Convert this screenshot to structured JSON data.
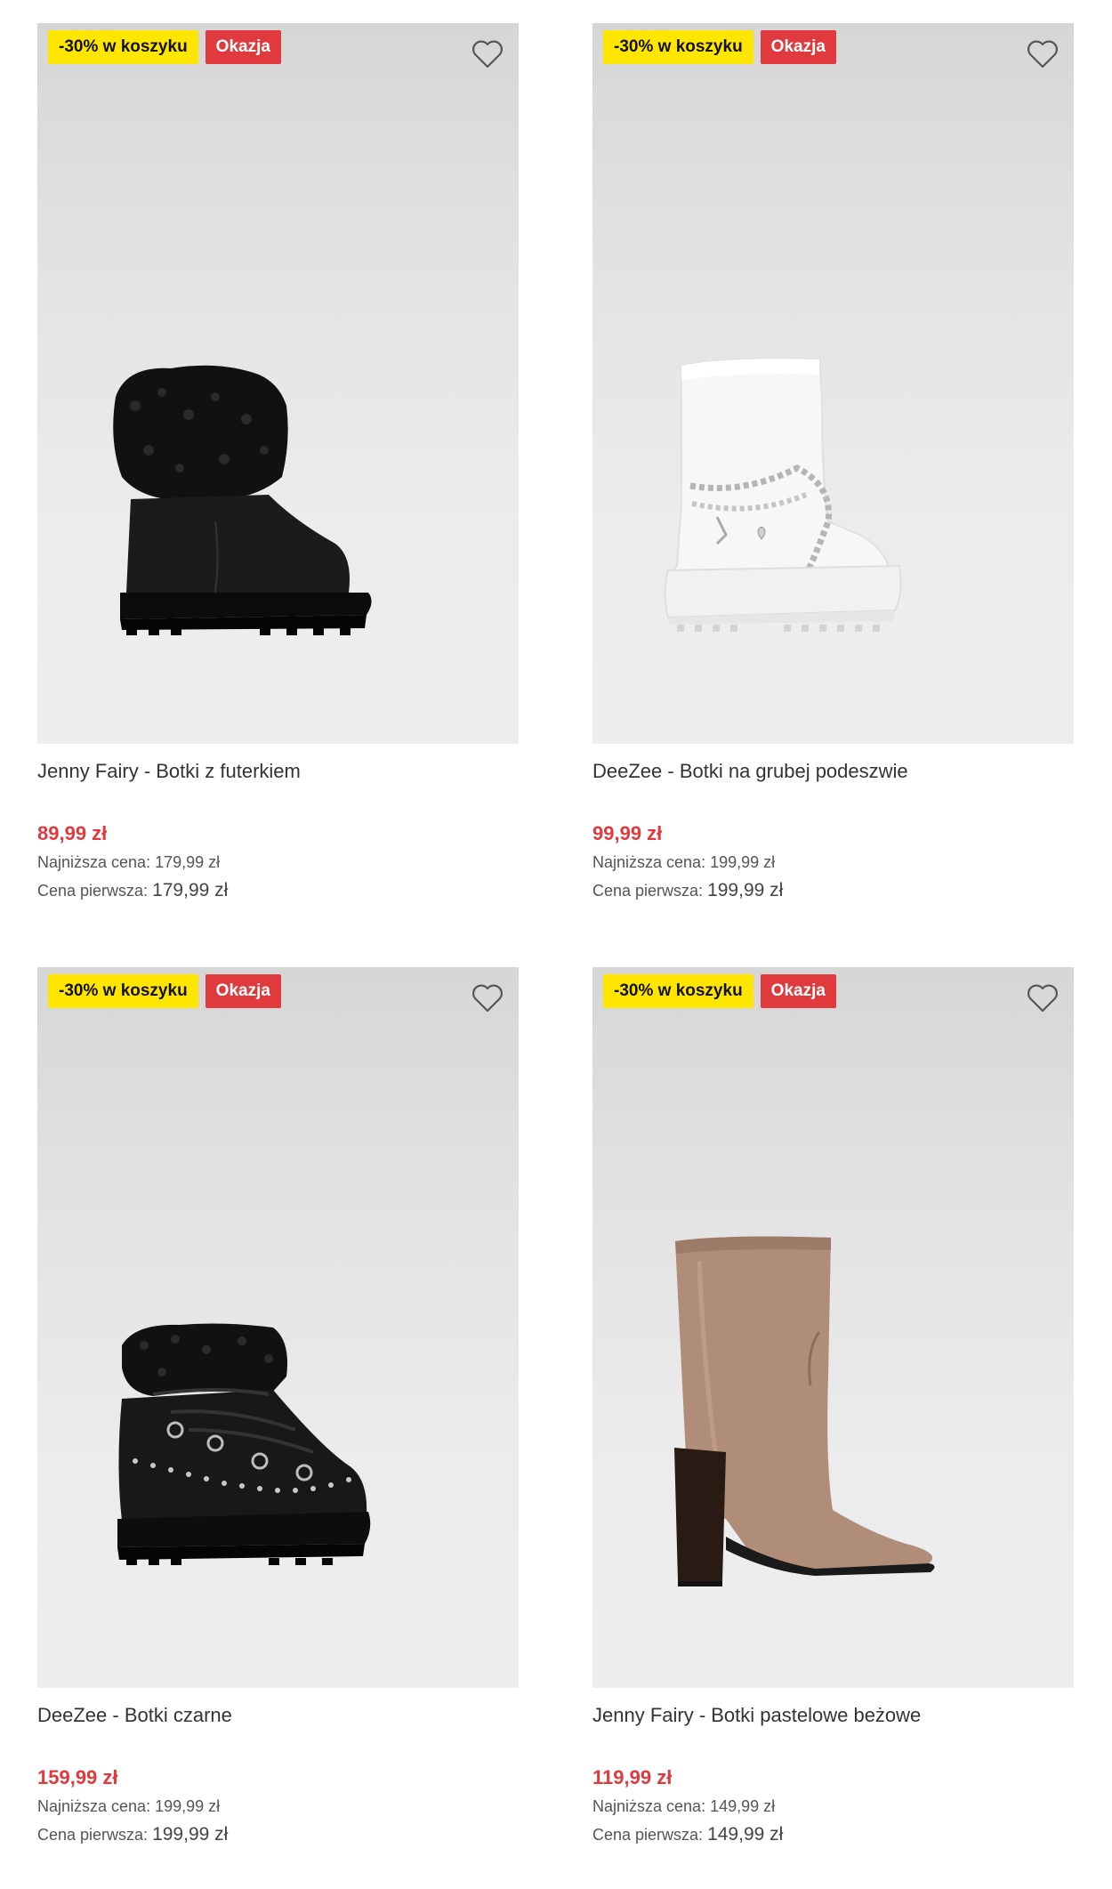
{
  "currency": "zł",
  "products": [
    {
      "promo_badge": "-30% w koszyku",
      "deal_badge": "Okazja",
      "title": "Jenny Fairy - Botki z futerkiem",
      "price": "89,99 zł",
      "lowest_label": "Najniższa cena:",
      "lowest_value": "179,99 zł",
      "original_label": "Cena pierwsza:",
      "original_value": "179,99 zł"
    },
    {
      "promo_badge": "-30% w koszyku",
      "deal_badge": "Okazja",
      "title": "DeeZee - Botki na grubej podeszwie",
      "price": "99,99 zł",
      "lowest_label": "Najniższa cena:",
      "lowest_value": "199,99 zł",
      "original_label": "Cena pierwsza:",
      "original_value": "199,99 zł"
    },
    {
      "promo_badge": "-30% w koszyku",
      "deal_badge": "Okazja",
      "title": "DeeZee - Botki czarne",
      "price": "159,99 zł",
      "lowest_label": "Najniższa cena:",
      "lowest_value": "199,99 zł",
      "original_label": "Cena pierwsza:",
      "original_value": "199,99 zł"
    },
    {
      "promo_badge": "-30% w koszyku",
      "deal_badge": "Okazja",
      "title": "Jenny Fairy - Botki pastelowe beżowe",
      "price": "119,99 zł",
      "lowest_label": "Najniższa cena:",
      "lowest_value": "149,99 zł",
      "original_label": "Cena pierwsza:",
      "original_value": "149,99 zł"
    }
  ],
  "icons": {
    "favorite": "heart-outline-icon"
  },
  "colors": {
    "promo": "#ffe600",
    "deal": "#e0393e",
    "price": "#e0393e"
  }
}
